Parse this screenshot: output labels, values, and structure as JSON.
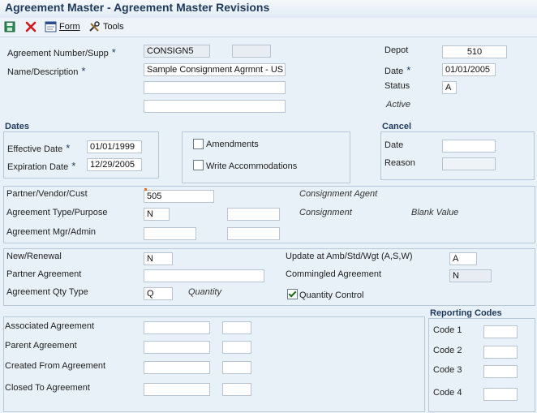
{
  "window": {
    "title": "Agreement Master - Agreement Master Revisions"
  },
  "toolbar": {
    "form_label": "Form",
    "tools_label": "Tools"
  },
  "header": {
    "agreement_number_label": "Agreement Number/Supp",
    "agreement_number_value": "CONSIGN5",
    "agreement_supp_value": "",
    "name_label": "Name/Description",
    "name_value": "Sample Consignment Agrmnt - US",
    "name_line2": "",
    "name_line3": "",
    "depot_label": "Depot",
    "depot_value": "510",
    "date_label": "Date",
    "date_value": "01/01/2005",
    "status_label": "Status",
    "status_value": "A",
    "status_desc": "Active",
    "required_mark": "*"
  },
  "dates": {
    "title": "Dates",
    "effective_label": "Effective Date",
    "effective_value": "01/01/1999",
    "expiration_label": "Expiration Date",
    "expiration_value": "12/29/2005",
    "amendments_label": "Amendments",
    "write_accommodations_label": "Write Accommodations"
  },
  "cancel": {
    "title": "Cancel",
    "date_label": "Date",
    "date_value": "",
    "reason_label": "Reason",
    "reason_value": ""
  },
  "partner": {
    "partner_label": "Partner/Vendor/Cust",
    "partner_value": "505",
    "partner_desc": "Consignment Agent",
    "type_label": "Agreement Type/Purpose",
    "type_value": "N",
    "type_value2": "",
    "type_desc": "Consignment",
    "purpose_desc": "Blank Value",
    "mgr_label": "Agreement Mgr/Admin",
    "mgr_value": "",
    "admin_value": ""
  },
  "details": {
    "new_renewal_label": "New/Renewal",
    "new_renewal_value": "N",
    "partner_agreement_label": "Partner Agreement",
    "partner_agreement_value": "",
    "qty_type_label": "Agreement Qty Type",
    "qty_type_value": "Q",
    "qty_type_desc": "Quantity",
    "update_label": "Update at Amb/Std/Wgt (A,S,W)",
    "update_value": "A",
    "commingled_label": "Commingled Agreement",
    "commingled_value": "N",
    "quantity_control_label": "Quantity Control"
  },
  "associated": {
    "associated_label": "Associated Agreement",
    "parent_label": "Parent Agreement",
    "created_from_label": "Created From Agreement",
    "closed_to_label": "Closed To Agreement"
  },
  "reporting": {
    "title": "Reporting Codes",
    "code1_label": "Code 1",
    "code2_label": "Code 2",
    "code3_label": "Code 3",
    "code4_label": "Code 4"
  },
  "colors": {
    "accent": "#1e3a5c",
    "background": "#e8f0f8",
    "required_marker": "#e07020"
  }
}
